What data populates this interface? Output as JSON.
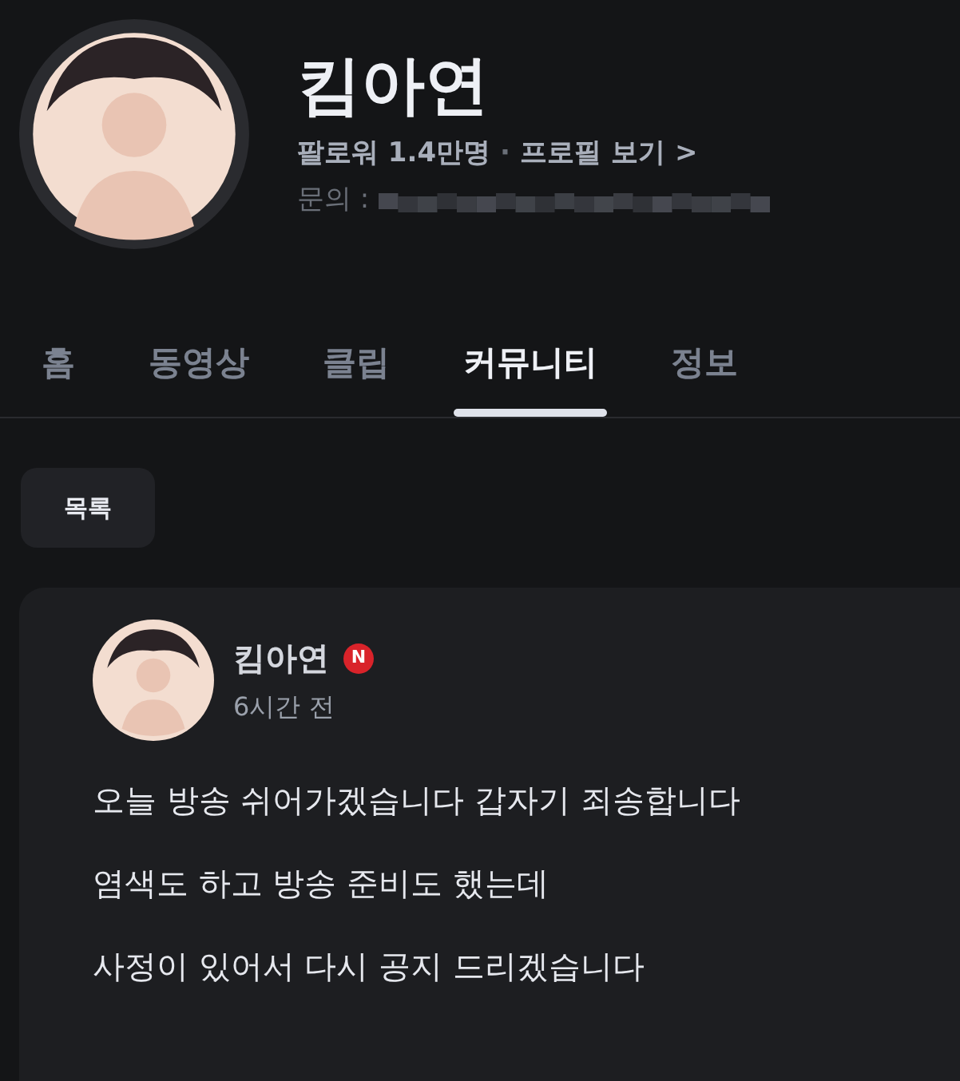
{
  "channel": {
    "name": "킴아연",
    "followers": "팔로워 1.4만명",
    "separator": "·",
    "profile_link": "프로필 보기",
    "profile_arrow": ">",
    "contact_label": "문의 :"
  },
  "tabs": [
    {
      "label": "홈",
      "selected": false
    },
    {
      "label": "동영상",
      "selected": false
    },
    {
      "label": "클립",
      "selected": false
    },
    {
      "label": "커뮤니티",
      "selected": true
    },
    {
      "label": "정보",
      "selected": false
    }
  ],
  "list_button": "목록",
  "post": {
    "author": "킴아연",
    "badge": "N",
    "time": "6시간 전",
    "paragraphs": [
      "오늘 방송 쉬어가겠습니다 갑자기 죄송합니다",
      "염색도 하고 방송 준비도 했는데",
      "사정이 있어서 다시 공지 드리겠습니다"
    ]
  }
}
